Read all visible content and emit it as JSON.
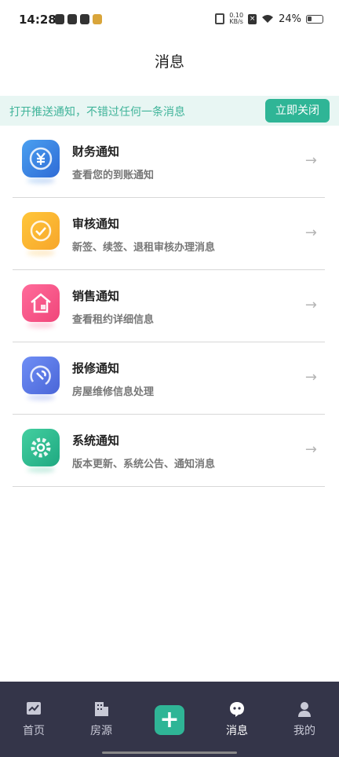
{
  "status_bar": {
    "time": "14:28",
    "net_speed_value": "0.10",
    "net_speed_unit": "KB/s",
    "battery": "24%"
  },
  "page": {
    "title": "消息"
  },
  "notice": {
    "text": "打开推送通知，不错过任何一条消息",
    "button": "立即关闭"
  },
  "messages": [
    {
      "title": "财务通知",
      "subtitle": "查看您的到账通知",
      "icon": "yen-icon",
      "color": "#3a84e6"
    },
    {
      "title": "审核通知",
      "subtitle": "新签、续签、退租审核办理消息",
      "icon": "check-circle-icon",
      "color": "#f8ae2f"
    },
    {
      "title": "销售通知",
      "subtitle": "查看租约详细信息",
      "icon": "house-icon",
      "color": "#f4527f"
    },
    {
      "title": "报修通知",
      "subtitle": "房屋维修信息处理",
      "icon": "wrench-icon",
      "color": "#5a76e3"
    },
    {
      "title": "系统通知",
      "subtitle": "版本更新、系统公告、通知消息",
      "icon": "gear-icon",
      "color": "#27b88e"
    }
  ],
  "nav": {
    "home": "首页",
    "listings": "房源",
    "add": "+",
    "messages": "消息",
    "mine": "我的"
  }
}
